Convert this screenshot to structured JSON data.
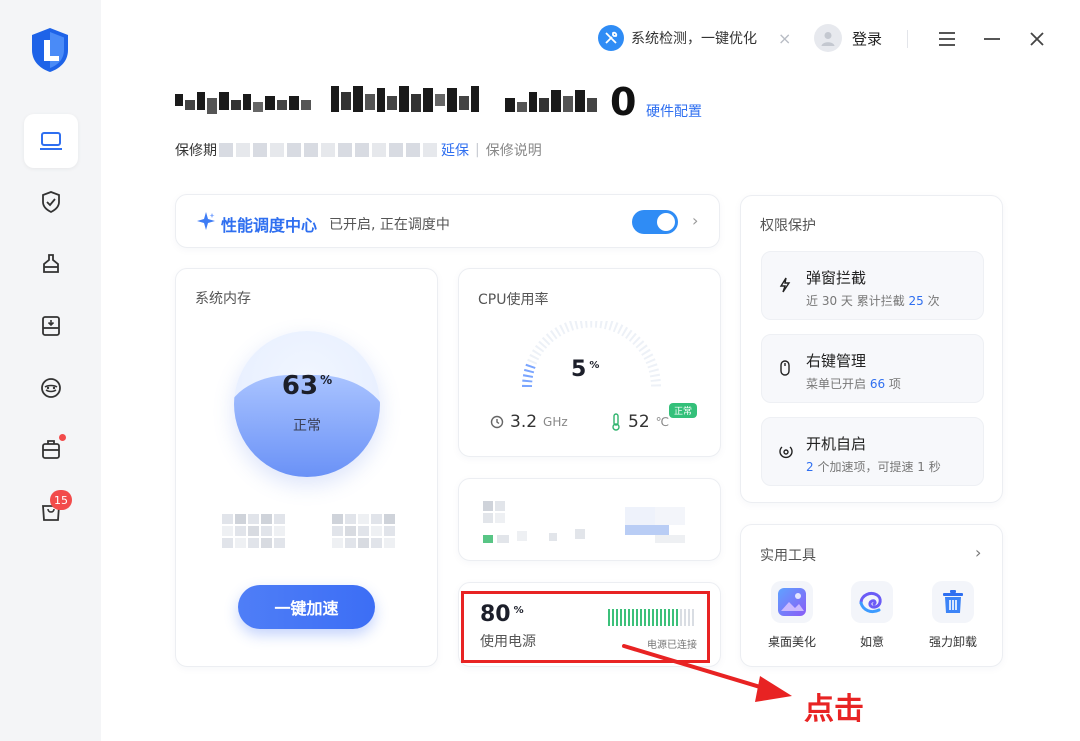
{
  "colors": {
    "accent": "#2f6ff0",
    "toggle": "#2f8cf5",
    "annotation": "#e82323",
    "ok": "#34c07a"
  },
  "titlebar": {
    "sys_check_label": "系统检测，一键优化",
    "sys_check_close": "×",
    "login_label": "登录",
    "icons": [
      "wrench-icon",
      "avatar-icon",
      "menu-icon",
      "minimize-icon",
      "close-icon"
    ]
  },
  "sidebar": {
    "items": [
      {
        "icon": "laptop-icon",
        "active": true
      },
      {
        "icon": "shield-check-icon"
      },
      {
        "icon": "cleaner-icon"
      },
      {
        "icon": "drive-icon"
      },
      {
        "icon": "game-icon"
      },
      {
        "icon": "toolbox-icon",
        "dot": true
      },
      {
        "icon": "bag-icon",
        "badge": "15"
      }
    ]
  },
  "header": {
    "device_suffix": "0",
    "hardware_link": "硬件配置",
    "warranty_label": "保修期",
    "warranty_extend": "延保",
    "warranty_sep": "|",
    "warranty_note": "保修说明"
  },
  "perf": {
    "title": "性能调度中心",
    "status": "已开启, 正在调度中",
    "toggle_on": true,
    "chevron": "›"
  },
  "memory": {
    "title": "系统内存",
    "value": "63",
    "unit": "%",
    "status": "正常",
    "button": "一键加速"
  },
  "cpu": {
    "title": "CPU使用率",
    "value": "5",
    "unit": "%",
    "freq": "3.2",
    "freq_unit": "GHz",
    "temp": "52",
    "temp_unit": "℃",
    "temp_badge": "正常"
  },
  "power": {
    "value": "80",
    "unit": "%",
    "label": "使用电源",
    "status": "电源已连接",
    "level": 0.8
  },
  "permission": {
    "title": "权限保护",
    "items": [
      {
        "icon": "lightning-icon",
        "name": "弹窗拦截",
        "desc_pre": "近 30 天 累计拦截 ",
        "desc_num": "25",
        "desc_post": " 次"
      },
      {
        "icon": "mouse-icon",
        "name": "右键管理",
        "desc_pre": "菜单已开启 ",
        "desc_num": "66",
        "desc_post": " 项"
      },
      {
        "icon": "power-on-icon",
        "name": "开机自启",
        "desc_pre": "",
        "desc_num": "2",
        "desc_post": " 个加速项，可提速 1 秒"
      }
    ]
  },
  "tools": {
    "title": "实用工具",
    "chevron": "›",
    "items": [
      {
        "icon": "desktop-beautify-icon",
        "label": "桌面美化"
      },
      {
        "icon": "ruyi-icon",
        "label": "如意"
      },
      {
        "icon": "trash-icon",
        "label": "强力卸载"
      }
    ]
  },
  "annotation": {
    "label": "点击"
  }
}
